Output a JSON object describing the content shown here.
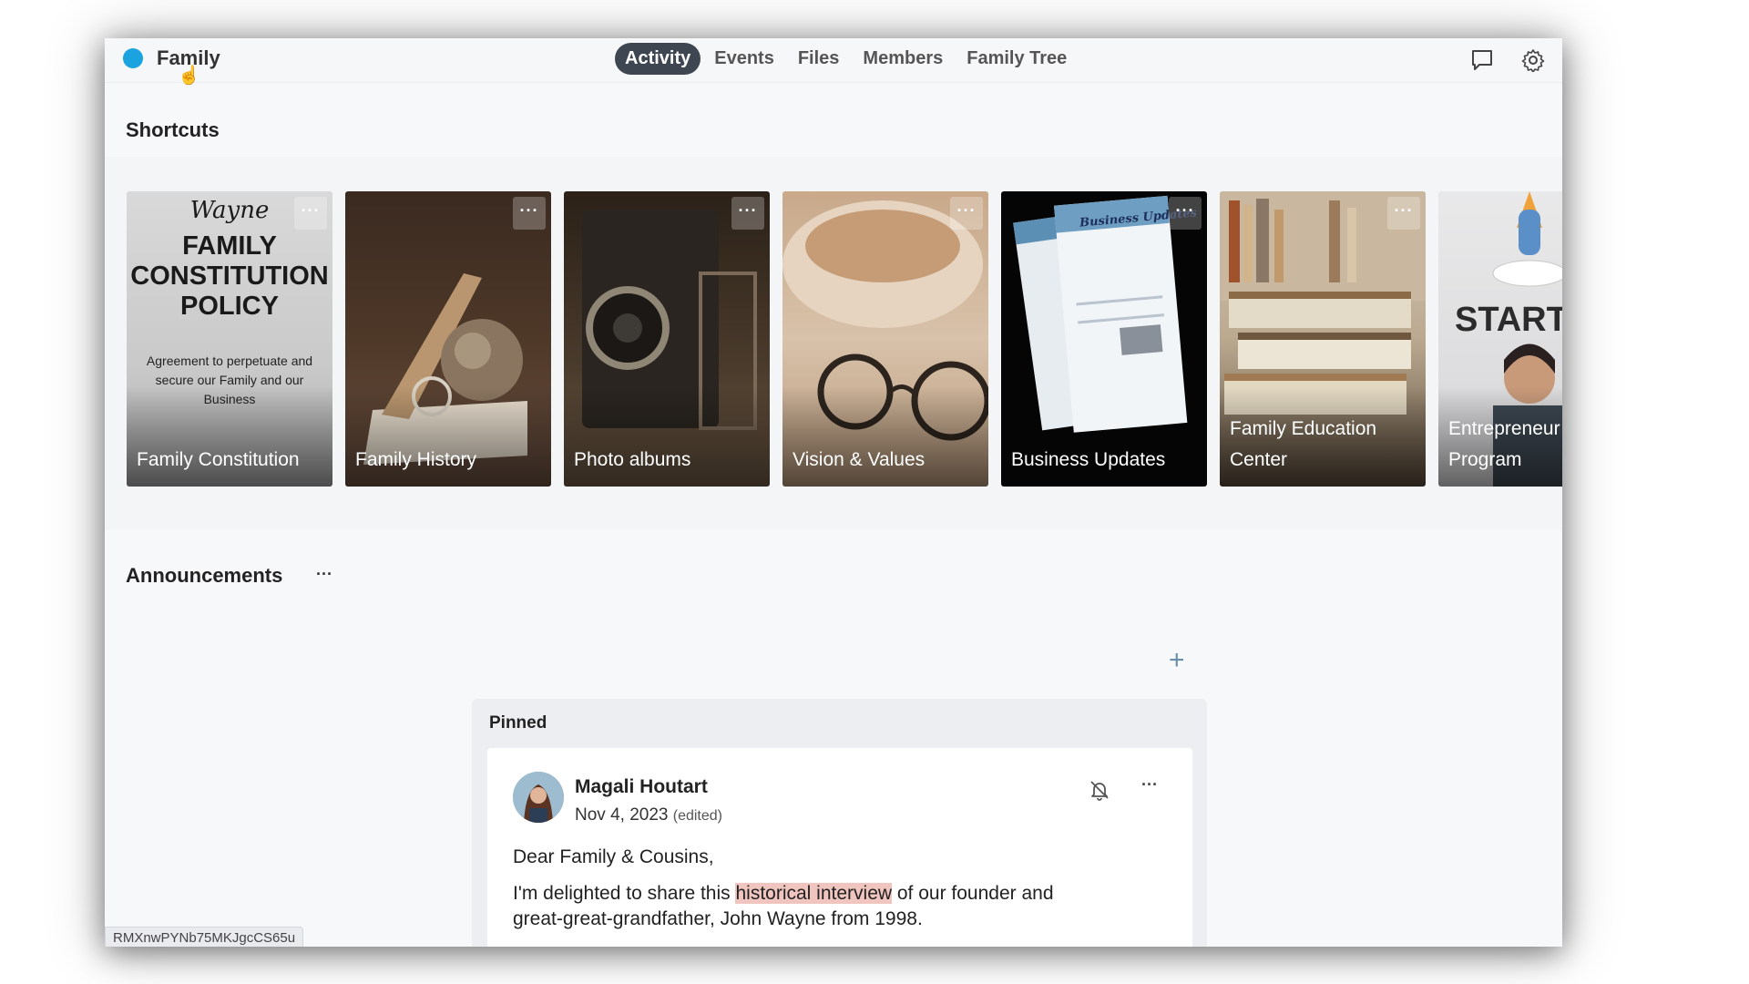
{
  "header": {
    "brand": "Family",
    "tabs": [
      {
        "label": "Activity",
        "active": true
      },
      {
        "label": "Events",
        "active": false
      },
      {
        "label": "Files",
        "active": false
      },
      {
        "label": "Members",
        "active": false
      },
      {
        "label": "Family Tree",
        "active": false
      }
    ],
    "icons": [
      "chat-icon",
      "settings-icon"
    ],
    "brand_color": "#1aa3de"
  },
  "shortcuts": {
    "title": "Shortcuts",
    "items": [
      {
        "label": "Family Constitution",
        "poster_script": "Wayne",
        "poster_title": "FAMILY CONSTITUTION POLICY",
        "poster_text": "Agreement to perpetuate and secure our Family and our Business"
      },
      {
        "label": "Family History"
      },
      {
        "label": "Photo albums"
      },
      {
        "label": "Vision & Values"
      },
      {
        "label": "Business Updates",
        "poster_title": "Business Updates"
      },
      {
        "label": "Family Education Center"
      },
      {
        "label": "Entrepreneur Program",
        "poster_title": "START"
      }
    ],
    "more_label": "···"
  },
  "announcements": {
    "title": "Announcements",
    "more_label": "···",
    "add_label": "+",
    "pinned": {
      "label": "Pinned",
      "author": "Magali Houtart",
      "date": "Nov 4, 2023",
      "edited": "(edited)",
      "greeting": "Dear Family & Cousins,",
      "body_before": "I'm delighted to share this ",
      "body_highlight": "historical interview",
      "body_after": " of our founder and",
      "body_line2": "great-great-grandfather, John Wayne from 1998."
    }
  },
  "status_tooltip": "RMXnwPYNb75MKJgcCS65u"
}
